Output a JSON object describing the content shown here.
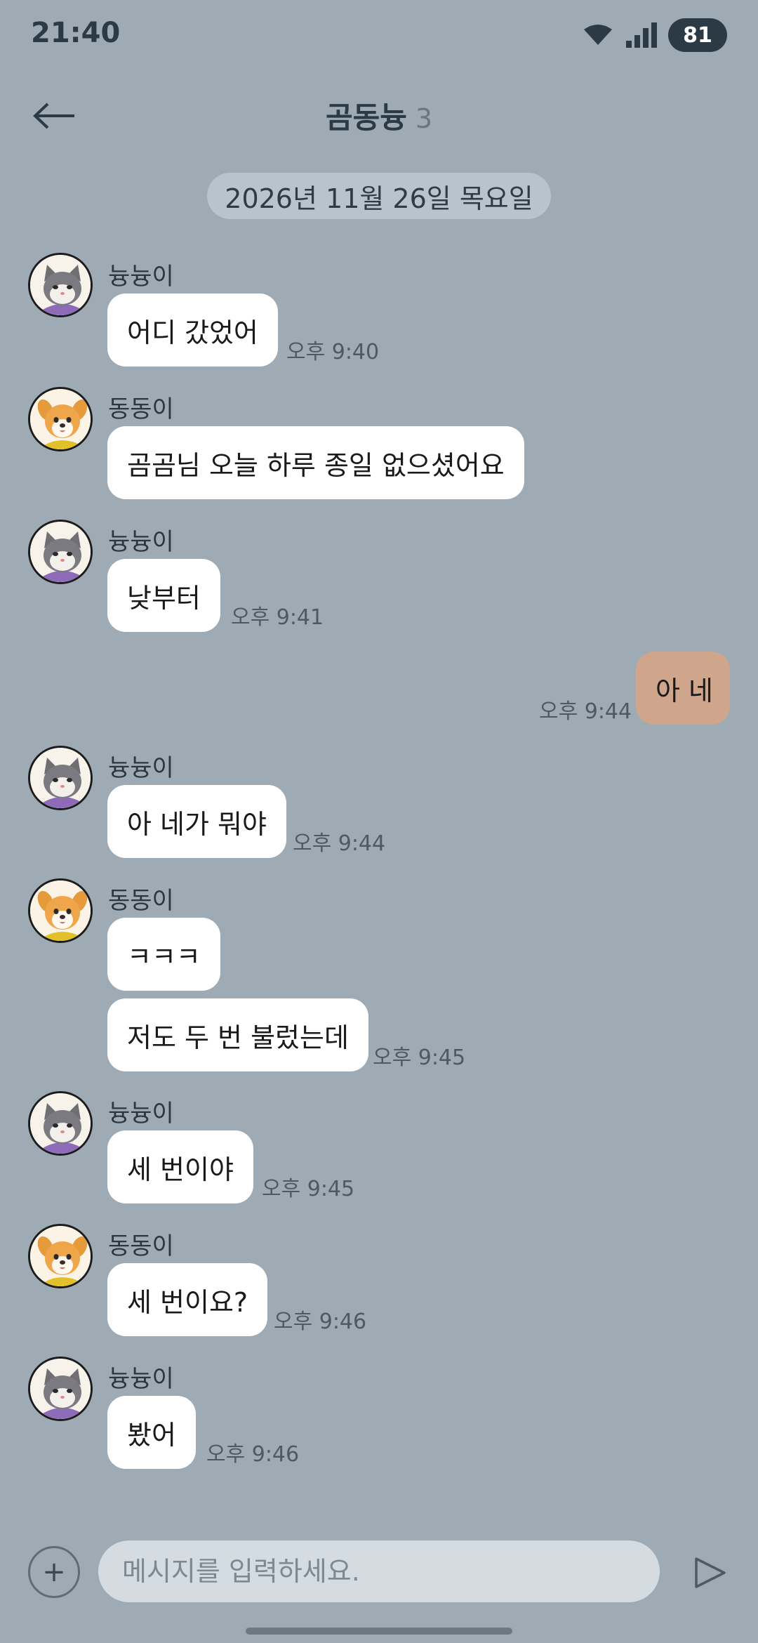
{
  "status": {
    "time": "21:40",
    "battery": "81"
  },
  "header": {
    "title": "곰동늉",
    "count": "3"
  },
  "date_separator": "2026년 11월 26일 목요일",
  "messages": [
    {
      "sender": "늉늉이",
      "text": "어디 갔었어",
      "time": "오후 9:40"
    },
    {
      "sender": "동동이",
      "text": "곰곰님 오늘 하루 종일 없으셨어요",
      "time": ""
    },
    {
      "sender": "늉늉이",
      "text": "낮부터",
      "time": "오후 9:41"
    },
    {
      "sender": "me",
      "text": "아 네",
      "time": "오후 9:44"
    },
    {
      "sender": "늉늉이",
      "text": "아 네가 뭐야",
      "time": "오후 9:44"
    },
    {
      "sender": "동동이",
      "text": "ㅋㅋㅋ",
      "time": ""
    },
    {
      "sender": "동동이",
      "text": "저도 두 번 불렀는데",
      "time": "오후 9:45"
    },
    {
      "sender": "늉늉이",
      "text": "세 번이야",
      "time": "오후 9:45"
    },
    {
      "sender": "동동이",
      "text": "세 번이요?",
      "time": "오후 9:46"
    },
    {
      "sender": "늉늉이",
      "text": "봤어",
      "time": "오후 9:46"
    }
  ],
  "input": {
    "placeholder": "메시지를 입력하세요.",
    "plus_label": "+"
  },
  "icons": {
    "back": "back-arrow-icon",
    "send": "send-icon",
    "wifi": "wifi-icon",
    "signal": "signal-icon"
  },
  "colors": {
    "background": "#9eabb5",
    "my_bubble": "#cfa58c",
    "other_bubble": "#ffffff"
  }
}
